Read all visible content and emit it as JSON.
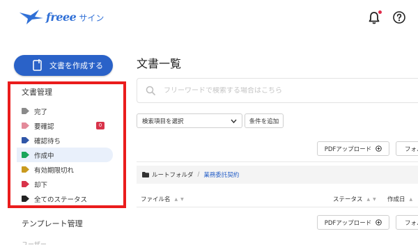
{
  "header": {
    "logo_word": "freee",
    "logo_suffix": "サイン"
  },
  "sidebar": {
    "create_button": "文書を作成する",
    "section_title": "文書管理",
    "statuses": [
      {
        "label": "完了",
        "color": "#8a8a8a"
      },
      {
        "label": "要確認",
        "color": "#e38a9a",
        "badge": "0"
      },
      {
        "label": "確認待ち",
        "color": "#2f56a8"
      },
      {
        "label": "作成中",
        "color": "#1aa65a"
      },
      {
        "label": "有効期限切れ",
        "color": "#c99a1e"
      },
      {
        "label": "却下",
        "color": "#d8334a"
      },
      {
        "label": "全てのステータス",
        "color": "#222222"
      }
    ],
    "template_link": "テンプレート管理",
    "cut_item": "ユーザー"
  },
  "main": {
    "title": "文書一覧",
    "search_placeholder": "フリーワードで検索する場合はこちら",
    "select_label": "検索項目を選択",
    "add_condition": "条件を追加",
    "upload_label": "PDFアップロード",
    "partial_button": "フォルダ",
    "breadcrumb": {
      "root": "ルートフォルダ",
      "current": "業務委託契約"
    },
    "columns": {
      "filename": "ファイル名",
      "status": "ステータス",
      "created": "作成日"
    }
  },
  "colors": {
    "accent": "#2a62c8",
    "highlight": "#ea1c1c",
    "active_bg": "#e9f0fb"
  }
}
